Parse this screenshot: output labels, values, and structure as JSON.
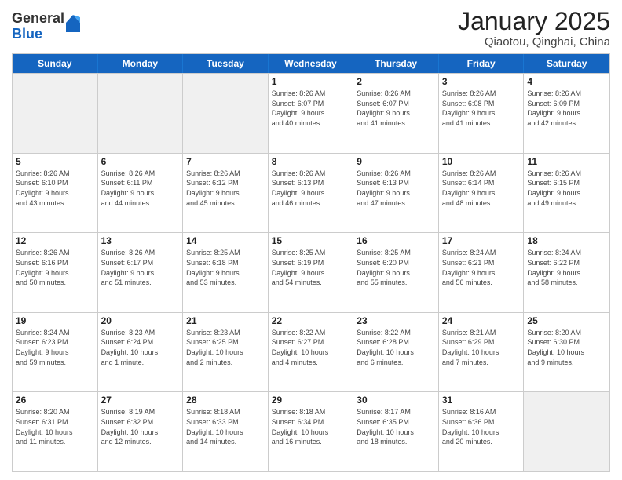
{
  "logo": {
    "general": "General",
    "blue": "Blue"
  },
  "header": {
    "title": "January 2025",
    "location": "Qiaotou, Qinghai, China"
  },
  "days_of_week": [
    "Sunday",
    "Monday",
    "Tuesday",
    "Wednesday",
    "Thursday",
    "Friday",
    "Saturday"
  ],
  "weeks": [
    [
      {
        "day": "",
        "info": "",
        "empty": true
      },
      {
        "day": "",
        "info": "",
        "empty": true
      },
      {
        "day": "",
        "info": "",
        "empty": true
      },
      {
        "day": "1",
        "info": "Sunrise: 8:26 AM\nSunset: 6:07 PM\nDaylight: 9 hours\nand 40 minutes."
      },
      {
        "day": "2",
        "info": "Sunrise: 8:26 AM\nSunset: 6:07 PM\nDaylight: 9 hours\nand 41 minutes."
      },
      {
        "day": "3",
        "info": "Sunrise: 8:26 AM\nSunset: 6:08 PM\nDaylight: 9 hours\nand 41 minutes."
      },
      {
        "day": "4",
        "info": "Sunrise: 8:26 AM\nSunset: 6:09 PM\nDaylight: 9 hours\nand 42 minutes."
      }
    ],
    [
      {
        "day": "5",
        "info": "Sunrise: 8:26 AM\nSunset: 6:10 PM\nDaylight: 9 hours\nand 43 minutes."
      },
      {
        "day": "6",
        "info": "Sunrise: 8:26 AM\nSunset: 6:11 PM\nDaylight: 9 hours\nand 44 minutes."
      },
      {
        "day": "7",
        "info": "Sunrise: 8:26 AM\nSunset: 6:12 PM\nDaylight: 9 hours\nand 45 minutes."
      },
      {
        "day": "8",
        "info": "Sunrise: 8:26 AM\nSunset: 6:13 PM\nDaylight: 9 hours\nand 46 minutes."
      },
      {
        "day": "9",
        "info": "Sunrise: 8:26 AM\nSunset: 6:13 PM\nDaylight: 9 hours\nand 47 minutes."
      },
      {
        "day": "10",
        "info": "Sunrise: 8:26 AM\nSunset: 6:14 PM\nDaylight: 9 hours\nand 48 minutes."
      },
      {
        "day": "11",
        "info": "Sunrise: 8:26 AM\nSunset: 6:15 PM\nDaylight: 9 hours\nand 49 minutes."
      }
    ],
    [
      {
        "day": "12",
        "info": "Sunrise: 8:26 AM\nSunset: 6:16 PM\nDaylight: 9 hours\nand 50 minutes."
      },
      {
        "day": "13",
        "info": "Sunrise: 8:26 AM\nSunset: 6:17 PM\nDaylight: 9 hours\nand 51 minutes."
      },
      {
        "day": "14",
        "info": "Sunrise: 8:25 AM\nSunset: 6:18 PM\nDaylight: 9 hours\nand 53 minutes."
      },
      {
        "day": "15",
        "info": "Sunrise: 8:25 AM\nSunset: 6:19 PM\nDaylight: 9 hours\nand 54 minutes."
      },
      {
        "day": "16",
        "info": "Sunrise: 8:25 AM\nSunset: 6:20 PM\nDaylight: 9 hours\nand 55 minutes."
      },
      {
        "day": "17",
        "info": "Sunrise: 8:24 AM\nSunset: 6:21 PM\nDaylight: 9 hours\nand 56 minutes."
      },
      {
        "day": "18",
        "info": "Sunrise: 8:24 AM\nSunset: 6:22 PM\nDaylight: 9 hours\nand 58 minutes."
      }
    ],
    [
      {
        "day": "19",
        "info": "Sunrise: 8:24 AM\nSunset: 6:23 PM\nDaylight: 9 hours\nand 59 minutes."
      },
      {
        "day": "20",
        "info": "Sunrise: 8:23 AM\nSunset: 6:24 PM\nDaylight: 10 hours\nand 1 minute."
      },
      {
        "day": "21",
        "info": "Sunrise: 8:23 AM\nSunset: 6:25 PM\nDaylight: 10 hours\nand 2 minutes."
      },
      {
        "day": "22",
        "info": "Sunrise: 8:22 AM\nSunset: 6:27 PM\nDaylight: 10 hours\nand 4 minutes."
      },
      {
        "day": "23",
        "info": "Sunrise: 8:22 AM\nSunset: 6:28 PM\nDaylight: 10 hours\nand 6 minutes."
      },
      {
        "day": "24",
        "info": "Sunrise: 8:21 AM\nSunset: 6:29 PM\nDaylight: 10 hours\nand 7 minutes."
      },
      {
        "day": "25",
        "info": "Sunrise: 8:20 AM\nSunset: 6:30 PM\nDaylight: 10 hours\nand 9 minutes."
      }
    ],
    [
      {
        "day": "26",
        "info": "Sunrise: 8:20 AM\nSunset: 6:31 PM\nDaylight: 10 hours\nand 11 minutes."
      },
      {
        "day": "27",
        "info": "Sunrise: 8:19 AM\nSunset: 6:32 PM\nDaylight: 10 hours\nand 12 minutes."
      },
      {
        "day": "28",
        "info": "Sunrise: 8:18 AM\nSunset: 6:33 PM\nDaylight: 10 hours\nand 14 minutes."
      },
      {
        "day": "29",
        "info": "Sunrise: 8:18 AM\nSunset: 6:34 PM\nDaylight: 10 hours\nand 16 minutes."
      },
      {
        "day": "30",
        "info": "Sunrise: 8:17 AM\nSunset: 6:35 PM\nDaylight: 10 hours\nand 18 minutes."
      },
      {
        "day": "31",
        "info": "Sunrise: 8:16 AM\nSunset: 6:36 PM\nDaylight: 10 hours\nand 20 minutes."
      },
      {
        "day": "",
        "info": "",
        "empty": true
      }
    ]
  ]
}
